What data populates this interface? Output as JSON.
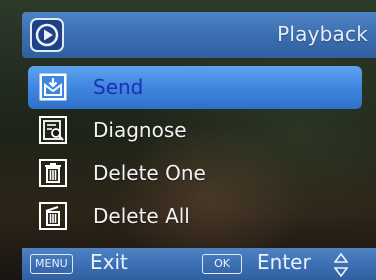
{
  "header": {
    "title": "Playback",
    "icon": "playback-icon"
  },
  "menu": {
    "items": [
      {
        "label": "Send",
        "icon": "send-icon",
        "selected": true
      },
      {
        "label": "Diagnose",
        "icon": "diagnose-icon",
        "selected": false
      },
      {
        "label": "Delete One",
        "icon": "delete-one-icon",
        "selected": false
      },
      {
        "label": "Delete All",
        "icon": "delete-all-icon",
        "selected": false
      }
    ]
  },
  "footer": {
    "menu_key": "MENU",
    "exit_label": "Exit",
    "ok_key": "OK",
    "enter_label": "Enter",
    "nav_icon": "up-down-arrows-icon"
  },
  "colors": {
    "bar": "#3a6db0",
    "selection": "#3f86e0",
    "selected_text": "#1b2fb5",
    "text": "#f2f2f2"
  }
}
